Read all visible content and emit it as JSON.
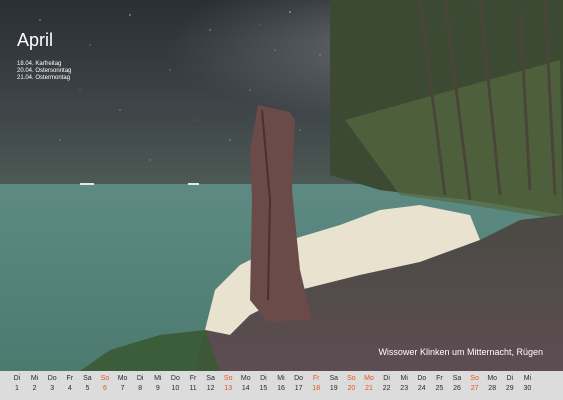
{
  "month": "April",
  "holidays": [
    "18.04. Karfreitag",
    "20.04. Ostersonntag",
    "21.04. Ostermontag"
  ],
  "caption": "Wissower Klinken um Mitternacht, Rügen",
  "colors": {
    "highlight": "#e8531c",
    "normal": "#2a2a2a",
    "strip": "#dcdcdc"
  },
  "calendar": [
    {
      "wd": "Di",
      "d": "1",
      "hl": false
    },
    {
      "wd": "Mi",
      "d": "2",
      "hl": false
    },
    {
      "wd": "Do",
      "d": "3",
      "hl": false
    },
    {
      "wd": "Fr",
      "d": "4",
      "hl": false
    },
    {
      "wd": "Sa",
      "d": "5",
      "hl": false
    },
    {
      "wd": "So",
      "d": "6",
      "hl": true
    },
    {
      "wd": "Mo",
      "d": "7",
      "hl": false
    },
    {
      "wd": "Di",
      "d": "8",
      "hl": false
    },
    {
      "wd": "Mi",
      "d": "9",
      "hl": false
    },
    {
      "wd": "Do",
      "d": "10",
      "hl": false
    },
    {
      "wd": "Fr",
      "d": "11",
      "hl": false
    },
    {
      "wd": "Sa",
      "d": "12",
      "hl": false
    },
    {
      "wd": "So",
      "d": "13",
      "hl": true
    },
    {
      "wd": "Mo",
      "d": "14",
      "hl": false
    },
    {
      "wd": "Di",
      "d": "15",
      "hl": false
    },
    {
      "wd": "Mi",
      "d": "16",
      "hl": false
    },
    {
      "wd": "Do",
      "d": "17",
      "hl": false
    },
    {
      "wd": "Fr",
      "d": "18",
      "hl": true
    },
    {
      "wd": "Sa",
      "d": "19",
      "hl": false
    },
    {
      "wd": "So",
      "d": "20",
      "hl": true
    },
    {
      "wd": "Mo",
      "d": "21",
      "hl": true
    },
    {
      "wd": "Di",
      "d": "22",
      "hl": false
    },
    {
      "wd": "Mi",
      "d": "23",
      "hl": false
    },
    {
      "wd": "Do",
      "d": "24",
      "hl": false
    },
    {
      "wd": "Fr",
      "d": "25",
      "hl": false
    },
    {
      "wd": "Sa",
      "d": "26",
      "hl": false
    },
    {
      "wd": "So",
      "d": "27",
      "hl": true
    },
    {
      "wd": "Mo",
      "d": "28",
      "hl": false
    },
    {
      "wd": "Di",
      "d": "29",
      "hl": false
    },
    {
      "wd": "Mi",
      "d": "30",
      "hl": false
    }
  ]
}
